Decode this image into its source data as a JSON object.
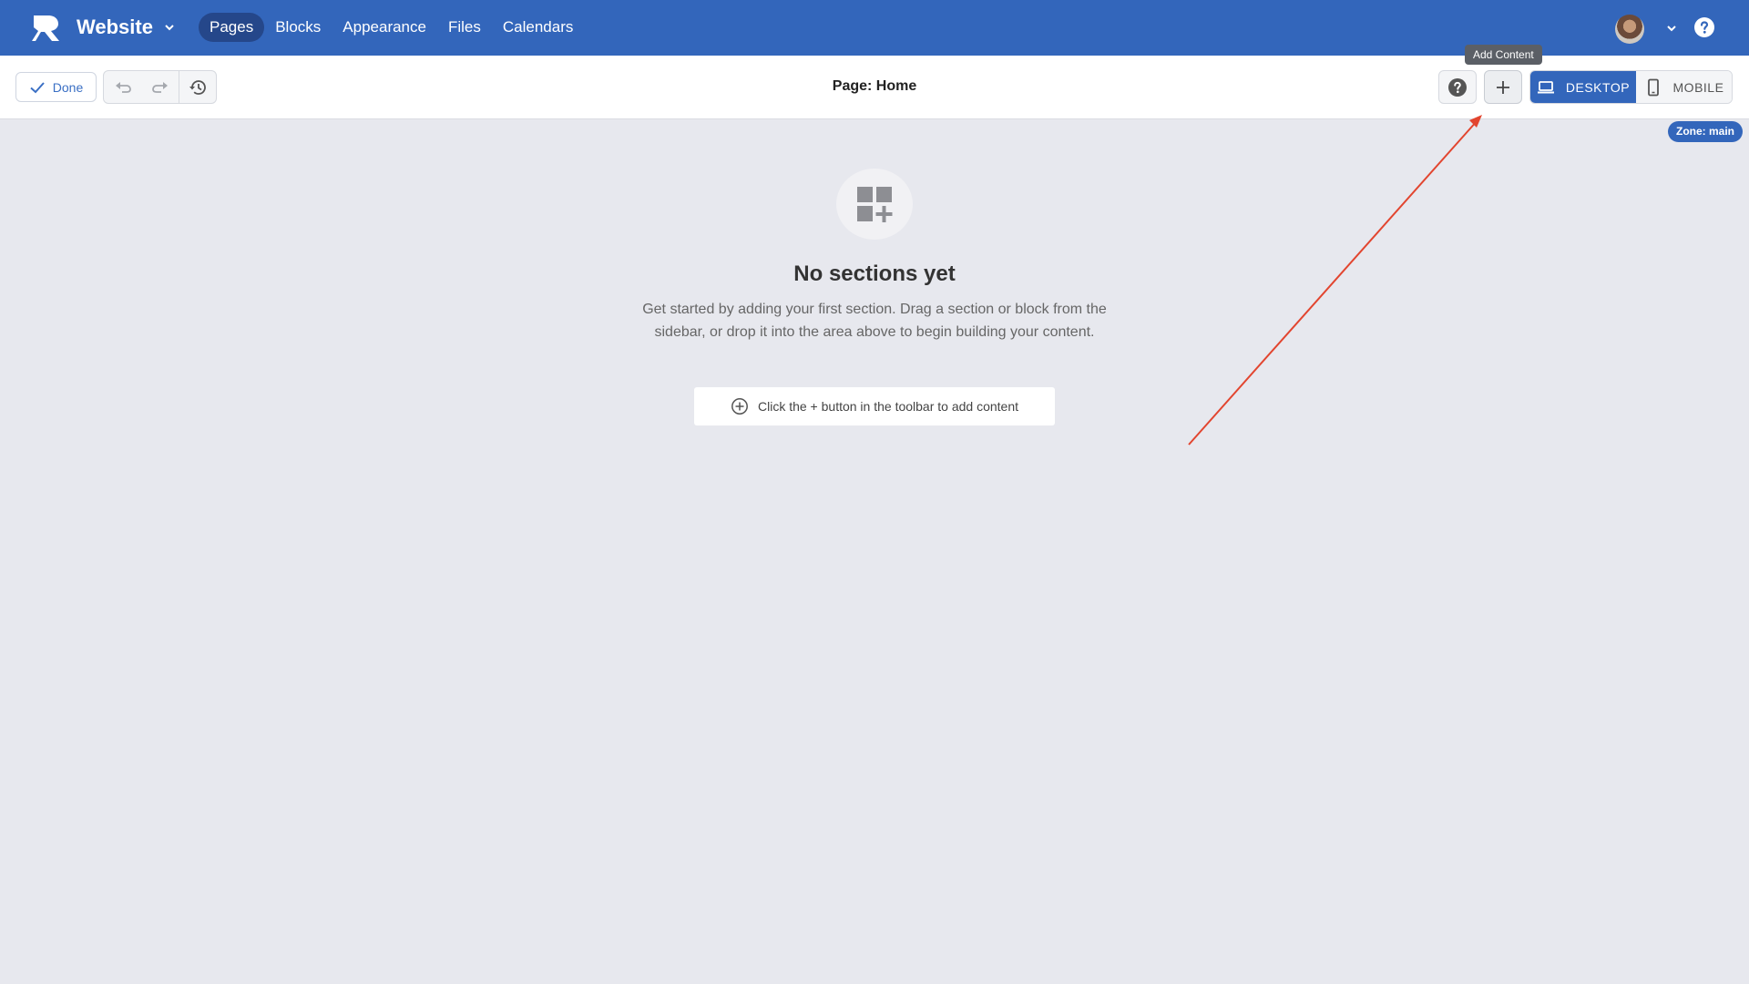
{
  "app": {
    "title": "Website"
  },
  "nav": {
    "items": [
      {
        "label": "Pages",
        "active": true
      },
      {
        "label": "Blocks",
        "active": false
      },
      {
        "label": "Appearance",
        "active": false
      },
      {
        "label": "Files",
        "active": false
      },
      {
        "label": "Calendars",
        "active": false
      }
    ]
  },
  "toolbar": {
    "done_label": "Done",
    "page_title": "Page: Home",
    "add_tooltip": "Add Content",
    "desktop_label": "DESKTOP",
    "mobile_label": "MOBILE",
    "zone_badge": "Zone: main"
  },
  "empty_state": {
    "title": "No sections yet",
    "description": "Get started by adding your first section. Drag a section or block from the sidebar, or drop it into the area above to begin building your content.",
    "hint": "Click the + button in the toolbar to add content"
  },
  "icons": {
    "logo": "brand-logo-icon",
    "site_dropdown": "chevron-down-icon",
    "account_dropdown": "chevron-down-icon",
    "help": "question-circle-icon",
    "done": "check-icon",
    "undo": "undo-icon",
    "redo": "redo-icon",
    "history": "history-icon",
    "add": "plus-icon",
    "desktop": "laptop-icon",
    "mobile": "phone-icon",
    "empty": "add-section-grid-icon",
    "hint": "plus-circle-icon"
  },
  "colors": {
    "brand": "#3366bb",
    "nav_active": "#25478a",
    "canvas_bg": "#e7e8ee",
    "annotation_arrow": "#e2452f"
  }
}
